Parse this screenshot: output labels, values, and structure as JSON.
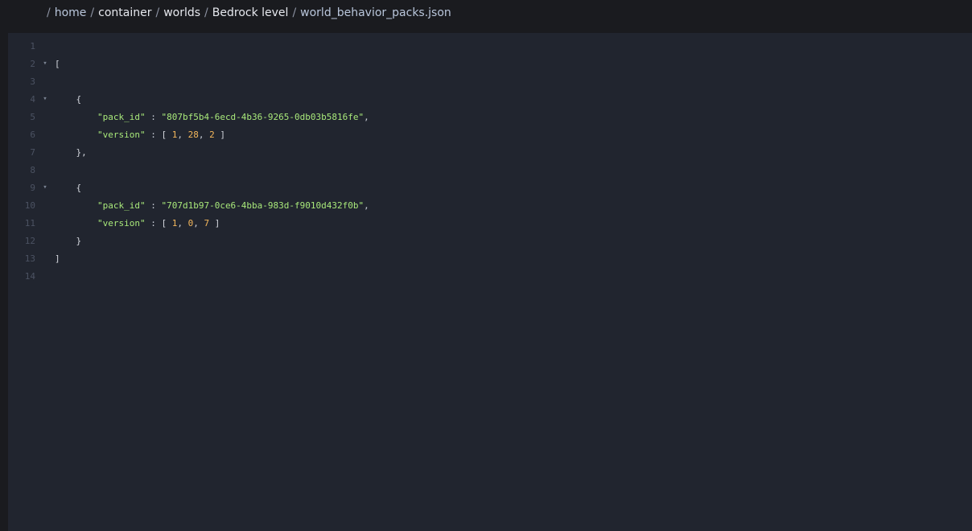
{
  "breadcrumb": {
    "separator": "/",
    "items": [
      {
        "label": "home"
      },
      {
        "label": "container"
      },
      {
        "label": "worlds"
      },
      {
        "label": "Bedrock level"
      },
      {
        "label": "world_behavior_packs.json"
      }
    ]
  },
  "editor": {
    "language": "json",
    "lines": [
      {
        "num": "1"
      },
      {
        "num": "2",
        "open": "["
      },
      {
        "num": "3"
      },
      {
        "num": "4",
        "open": "{"
      },
      {
        "num": "5",
        "key": "\"pack_id\"",
        "colon": " : ",
        "value": "\"807bf5b4-6ecd-4b36-9265-0db03b5816fe\"",
        "trail": ","
      },
      {
        "num": "6",
        "key": "\"version\"",
        "colon": " : ",
        "arr_open": "[ ",
        "n1": "1",
        "c1": ", ",
        "n2": "28",
        "c2": ", ",
        "n3": "2",
        "arr_close": " ]"
      },
      {
        "num": "7",
        "close": "},"
      },
      {
        "num": "8"
      },
      {
        "num": "9",
        "open": "{"
      },
      {
        "num": "10",
        "key": "\"pack_id\"",
        "colon": " : ",
        "value": "\"707d1b97-0ce6-4bba-983d-f9010d432f0b\"",
        "trail": ","
      },
      {
        "num": "11",
        "key": "\"version\"",
        "colon": " : ",
        "arr_open": "[ ",
        "n1": "1",
        "c1": ", ",
        "n2": "0",
        "c2": ", ",
        "n3": "7",
        "arr_close": " ]"
      },
      {
        "num": "12",
        "close": "}"
      },
      {
        "num": "13",
        "close": "]"
      },
      {
        "num": "14"
      }
    ],
    "fold_icon": "▾"
  }
}
